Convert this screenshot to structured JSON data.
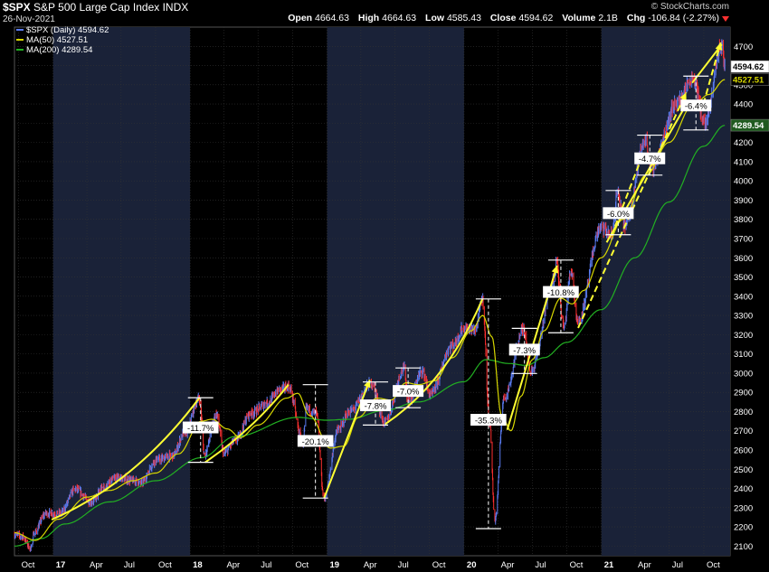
{
  "header": {
    "symbol": "$SPX",
    "name": "S&P 500 Large Cap Index",
    "exchange": "INDX",
    "date": "26-Nov-2021",
    "brand": "© StockCharts.com",
    "open_label": "Open",
    "open": "4664.63",
    "high_label": "High",
    "high": "4664.63",
    "low_label": "Low",
    "low": "4585.43",
    "close_label": "Close",
    "close": "4594.62",
    "volume_label": "Volume",
    "volume": "2.1B",
    "chg_label": "Chg",
    "chg": "-106.84 (-2.27%)"
  },
  "legend": {
    "price": "$SPX (Daily) 4594.62",
    "ma50": "MA(50) 4527.51",
    "ma200": "MA(200) 4289.54"
  },
  "colors": {
    "background": "#000000",
    "shade": "#1a2238",
    "grid": "#333333",
    "price_up": "#5b7cf2",
    "price_down": "#ff3030",
    "ma50": "#d7d700",
    "ma200": "#22b022",
    "trend": "#ffff33",
    "measure": "#ffffff"
  },
  "chart_data": {
    "type": "line",
    "y_axis": {
      "min": 2050,
      "max": 4800,
      "position": "right",
      "ticks": [
        2100,
        2200,
        2300,
        2400,
        2500,
        2600,
        2700,
        2800,
        2900,
        3000,
        3100,
        3200,
        3300,
        3400,
        3500,
        3600,
        3700,
        3800,
        3900,
        4000,
        4100,
        4200,
        4300,
        4400,
        4500,
        4600,
        4700
      ]
    },
    "x_axis": {
      "labels": [
        "Oct",
        "17",
        "Apr",
        "Jul",
        "Oct",
        "18",
        "Apr",
        "Jul",
        "Oct",
        "19",
        "Apr",
        "Jul",
        "Oct",
        "20",
        "Apr",
        "Jul",
        "Oct",
        "21",
        "Apr",
        "Jul",
        "Oct"
      ],
      "dates": [
        "2016-10-01",
        "2017-01-01",
        "2017-04-01",
        "2017-07-01",
        "2017-10-01",
        "2018-01-01",
        "2018-04-01",
        "2018-07-01",
        "2018-10-01",
        "2019-01-01",
        "2019-04-01",
        "2019-07-01",
        "2019-10-01",
        "2020-01-01",
        "2020-04-01",
        "2020-07-01",
        "2020-10-01",
        "2021-01-01",
        "2021-04-01",
        "2021-07-01",
        "2021-10-01"
      ],
      "start": "2016-09-20",
      "end": "2021-12-10"
    },
    "shaded_years": [
      [
        "2017-01-01",
        "2018-01-01"
      ],
      [
        "2019-01-01",
        "2020-01-01"
      ],
      [
        "2021-01-01",
        "2021-12-10"
      ]
    ],
    "grid": true,
    "legend_position": "top-left",
    "price_anchors": [
      [
        "2016-09-20",
        2160
      ],
      [
        "2016-10-10",
        2150
      ],
      [
        "2016-11-04",
        2085
      ],
      [
        "2016-11-10",
        2165
      ],
      [
        "2016-12-13",
        2270
      ],
      [
        "2017-01-20",
        2270
      ],
      [
        "2017-03-01",
        2395
      ],
      [
        "2017-04-13",
        2330
      ],
      [
        "2017-05-15",
        2405
      ],
      [
        "2017-06-19",
        2455
      ],
      [
        "2017-08-10",
        2440
      ],
      [
        "2017-08-21",
        2425
      ],
      [
        "2017-10-05",
        2550
      ],
      [
        "2017-11-15",
        2570
      ],
      [
        "2017-12-18",
        2690
      ],
      [
        "2018-01-26",
        2870
      ],
      [
        "2018-02-08",
        2580
      ],
      [
        "2018-03-12",
        2785
      ],
      [
        "2018-04-02",
        2580
      ],
      [
        "2018-05-01",
        2650
      ],
      [
        "2018-06-12",
        2790
      ],
      [
        "2018-07-25",
        2845
      ],
      [
        "2018-08-29",
        2915
      ],
      [
        "2018-09-20",
        2930
      ],
      [
        "2018-10-29",
        2640
      ],
      [
        "2018-11-07",
        2815
      ],
      [
        "2018-12-03",
        2790
      ],
      [
        "2018-12-24",
        2350
      ],
      [
        "2019-01-31",
        2705
      ],
      [
        "2019-03-01",
        2800
      ],
      [
        "2019-04-30",
        2945
      ],
      [
        "2019-06-03",
        2745
      ],
      [
        "2019-07-26",
        3025
      ],
      [
        "2019-08-05",
        2845
      ],
      [
        "2019-09-12",
        3010
      ],
      [
        "2019-10-03",
        2885
      ],
      [
        "2019-11-29",
        3140
      ],
      [
        "2019-12-31",
        3230
      ],
      [
        "2020-01-31",
        3225
      ],
      [
        "2020-02-19",
        3386
      ],
      [
        "2020-03-09",
        2750
      ],
      [
        "2020-03-23",
        2237
      ],
      [
        "2020-04-17",
        2875
      ],
      [
        "2020-06-08",
        3230
      ],
      [
        "2020-06-26",
        3010
      ],
      [
        "2020-08-31",
        3500
      ],
      [
        "2020-09-02",
        3580
      ],
      [
        "2020-09-23",
        3235
      ],
      [
        "2020-10-12",
        3535
      ],
      [
        "2020-10-30",
        3270
      ],
      [
        "2020-12-31",
        3756
      ],
      [
        "2021-01-29",
        3715
      ],
      [
        "2021-02-12",
        3935
      ],
      [
        "2021-03-04",
        3770
      ],
      [
        "2021-04-29",
        4210
      ],
      [
        "2021-05-12",
        4065
      ],
      [
        "2021-07-23",
        4410
      ],
      [
        "2021-09-02",
        4536
      ],
      [
        "2021-10-04",
        4300
      ],
      [
        "2021-11-18",
        4704
      ],
      [
        "2021-11-26",
        4594
      ]
    ],
    "ma50_anchors": [
      [
        "2016-09-20",
        2170
      ],
      [
        "2016-11-15",
        2130
      ],
      [
        "2017-01-15",
        2240
      ],
      [
        "2017-04-01",
        2355
      ],
      [
        "2017-06-01",
        2390
      ],
      [
        "2017-08-01",
        2440
      ],
      [
        "2017-10-01",
        2480
      ],
      [
        "2017-12-01",
        2580
      ],
      [
        "2018-01-31",
        2750
      ],
      [
        "2018-02-28",
        2760
      ],
      [
        "2018-04-10",
        2710
      ],
      [
        "2018-05-15",
        2665
      ],
      [
        "2018-07-01",
        2730
      ],
      [
        "2018-09-15",
        2870
      ],
      [
        "2018-10-15",
        2895
      ],
      [
        "2018-11-15",
        2780
      ],
      [
        "2019-01-10",
        2610
      ],
      [
        "2019-02-15",
        2620
      ],
      [
        "2019-03-25",
        2770
      ],
      [
        "2019-05-15",
        2870
      ],
      [
        "2019-06-20",
        2860
      ],
      [
        "2019-07-31",
        2950
      ],
      [
        "2019-09-01",
        2940
      ],
      [
        "2019-10-15",
        2960
      ],
      [
        "2019-12-01",
        3080
      ],
      [
        "2020-01-20",
        3220
      ],
      [
        "2020-02-20",
        3300
      ],
      [
        "2020-03-15",
        3190
      ],
      [
        "2020-04-10",
        2780
      ],
      [
        "2020-05-05",
        2700
      ],
      [
        "2020-06-01",
        2880
      ],
      [
        "2020-07-01",
        3070
      ],
      [
        "2020-08-01",
        3220
      ],
      [
        "2020-09-15",
        3390
      ],
      [
        "2020-10-15",
        3360
      ],
      [
        "2020-11-15",
        3430
      ],
      [
        "2020-12-31",
        3600
      ],
      [
        "2021-02-28",
        3800
      ],
      [
        "2021-04-30",
        4030
      ],
      [
        "2021-06-30",
        4200
      ],
      [
        "2021-08-31",
        4390
      ],
      [
        "2021-10-15",
        4450
      ],
      [
        "2021-11-26",
        4527
      ]
    ],
    "ma200_anchors": [
      [
        "2016-09-20",
        2100
      ],
      [
        "2016-12-01",
        2140
      ],
      [
        "2017-02-01",
        2215
      ],
      [
        "2017-06-01",
        2330
      ],
      [
        "2017-10-01",
        2440
      ],
      [
        "2018-01-31",
        2560
      ],
      [
        "2018-05-01",
        2670
      ],
      [
        "2018-10-15",
        2770
      ],
      [
        "2018-12-31",
        2755
      ],
      [
        "2019-03-01",
        2760
      ],
      [
        "2019-06-01",
        2805
      ],
      [
        "2019-09-01",
        2850
      ],
      [
        "2019-12-31",
        2955
      ],
      [
        "2020-02-28",
        3070
      ],
      [
        "2020-04-30",
        3050
      ],
      [
        "2020-06-15",
        3040
      ],
      [
        "2020-08-01",
        3080
      ],
      [
        "2020-10-01",
        3160
      ],
      [
        "2020-12-31",
        3330
      ],
      [
        "2021-03-31",
        3600
      ],
      [
        "2021-06-30",
        3890
      ],
      [
        "2021-09-30",
        4180
      ],
      [
        "2021-11-26",
        4289
      ]
    ],
    "trendlines": [
      {
        "style": "solid",
        "arrow": false,
        "points": [
          [
            "2016-12-28",
            2238
          ],
          [
            "2017-08-10",
            2430
          ],
          [
            "2018-01-26",
            2872
          ]
        ]
      },
      {
        "style": "solid",
        "arrow": false,
        "points": [
          [
            "2018-02-10",
            2536
          ],
          [
            "2018-06-20",
            2710
          ],
          [
            "2018-09-20",
            2940
          ]
        ]
      },
      {
        "style": "solid",
        "arrow": true,
        "points": [
          [
            "2018-12-24",
            2350
          ],
          [
            "2019-04-25",
            2965
          ]
        ]
      },
      {
        "style": "solid",
        "arrow": false,
        "points": [
          [
            "2019-06-05",
            2735
          ],
          [
            "2019-11-15",
            2950
          ],
          [
            "2020-02-19",
            3385
          ]
        ]
      },
      {
        "style": "solid",
        "arrow": true,
        "points": [
          [
            "2020-04-25",
            2705
          ],
          [
            "2020-09-05",
            3560
          ]
        ]
      },
      {
        "style": "dashed",
        "arrow": true,
        "points": [
          [
            "2020-10-31",
            3235
          ],
          [
            "2021-08-15",
            4460
          ]
        ]
      },
      {
        "style": "solid",
        "arrow": false,
        "points": [
          [
            "2021-01-15",
            3680
          ],
          [
            "2021-08-10",
            4380
          ]
        ]
      },
      {
        "style": "dashed",
        "arrow": true,
        "points": [
          [
            "2021-01-28",
            3715
          ],
          [
            "2021-04-20",
            4130
          ]
        ]
      },
      {
        "style": "dashed",
        "arrow": true,
        "points": [
          [
            "2021-09-30",
            4400
          ],
          [
            "2021-11-15",
            4720
          ]
        ]
      },
      {
        "style": "solid",
        "arrow": false,
        "points": [
          [
            "2021-08-31",
            4510
          ],
          [
            "2021-11-18",
            4710
          ]
        ]
      }
    ],
    "drawdowns": [
      {
        "label": "-11.7%",
        "date": "2018-01-29",
        "high": 2872,
        "low": 2536,
        "label_value": 2715
      },
      {
        "label": "-20.1%",
        "date": "2018-12-01",
        "high": 2940,
        "low": 2350,
        "label_value": 2645
      },
      {
        "label": "-7.8%",
        "date": "2019-05-10",
        "high": 2954,
        "low": 2730,
        "label_value": 2830
      },
      {
        "label": "-7.0%",
        "date": "2019-08-05",
        "high": 3027,
        "low": 2820,
        "label_value": 2905
      },
      {
        "label": "-35.3%",
        "date": "2020-03-06",
        "high": 3386,
        "low": 2191,
        "label_value": 2755
      },
      {
        "label": "-7.3%",
        "date": "2020-06-10",
        "high": 3233,
        "low": 2998,
        "label_value": 3120
      },
      {
        "label": "-10.8%",
        "date": "2020-09-15",
        "high": 3588,
        "low": 3210,
        "label_value": 3420
      },
      {
        "label": "-6.0%",
        "date": "2021-02-15",
        "high": 3950,
        "low": 3720,
        "label_value": 3830
      },
      {
        "label": "-4.7%",
        "date": "2021-05-10",
        "high": 4238,
        "low": 4030,
        "label_value": 4115
      },
      {
        "label": "-6.4%",
        "date": "2021-09-10",
        "high": 4545,
        "low": 4265,
        "label_value": 4390
      }
    ],
    "price_tags": [
      {
        "label": "4594.62",
        "value": 4594.62,
        "bg": "#ffffff",
        "fg": "#000000"
      },
      {
        "label": "4527.51",
        "value": 4527.51,
        "bg": "#000000",
        "fg": "#d7d700"
      },
      {
        "label": "4289.54",
        "value": 4289.54,
        "bg": "#1f5a1f",
        "fg": "#ffffff"
      }
    ]
  }
}
